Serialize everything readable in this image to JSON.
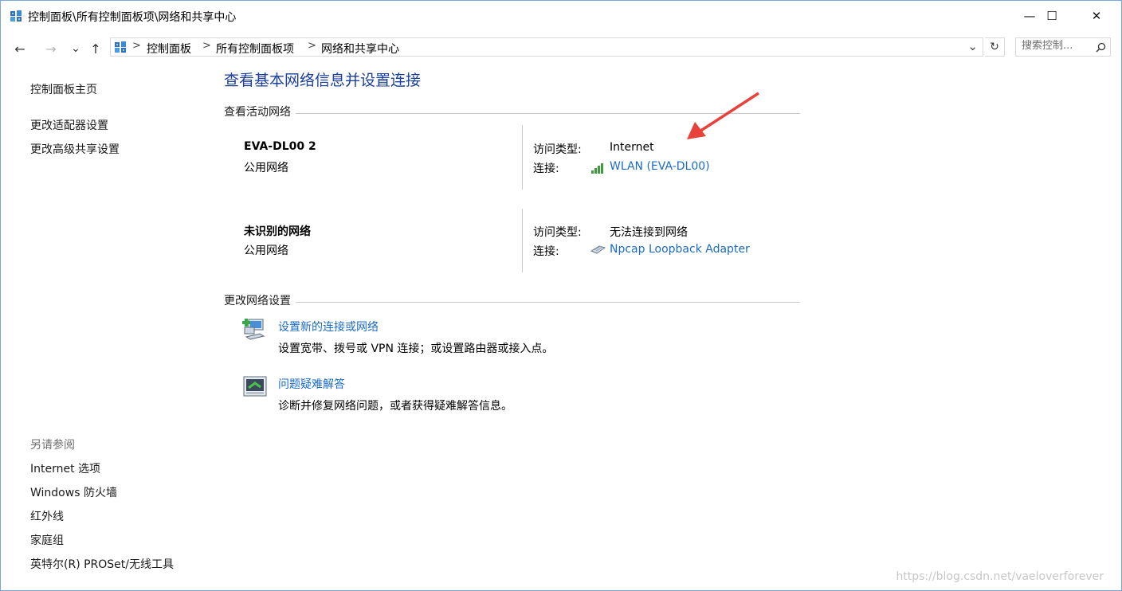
{
  "window": {
    "title": "控制面板\\所有控制面板项\\网络和共享中心",
    "minimize": "—",
    "maximize": "☐",
    "close": "✕"
  },
  "nav": {
    "back": "←",
    "forward": "→",
    "recent": "⌄",
    "up": "↑",
    "breadcrumb": [
      "控制面板",
      "所有控制面板项",
      "网络和共享中心"
    ],
    "separator": ">",
    "dropdown": "⌄",
    "refresh": "↻"
  },
  "search": {
    "placeholder": "搜索控制..."
  },
  "sidebar": {
    "home": "控制面板主页",
    "links": [
      "更改适配器设置",
      "更改高级共享设置"
    ],
    "see_also_label": "另请参阅",
    "see_also": [
      "Internet 选项",
      "Windows 防火墙",
      "红外线",
      "家庭组",
      "英特尔(R) PROSet/无线工具"
    ]
  },
  "main": {
    "title": "查看基本网络信息并设置连接",
    "active_label": "查看活动网络",
    "networks": [
      {
        "name": "EVA-DL00  2",
        "type": "公用网络",
        "access_label": "访问类型:",
        "access": "Internet",
        "conn_label": "连接:",
        "conn": "WLAN (EVA-DL00)",
        "icon": "wifi-signal-icon"
      },
      {
        "name": "未识别的网络",
        "type": "公用网络",
        "access_label": "访问类型:",
        "access": "无法连接到网络",
        "conn_label": "连接:",
        "conn": "Npcap Loopback Adapter",
        "icon": "ethernet-adapter-icon"
      }
    ],
    "change_label": "更改网络设置",
    "tasks": [
      {
        "link": "设置新的连接或网络",
        "desc": "设置宽带、拨号或 VPN 连接；或设置路由器或接入点。",
        "icon": "new-connection-icon"
      },
      {
        "link": "问题疑难解答",
        "desc": "诊断并修复网络问题，或者获得疑难解答信息。",
        "icon": "troubleshoot-icon"
      }
    ]
  },
  "watermark": "https://blog.csdn.net/vaeloverforever",
  "colors": {
    "link": "#1a6bc6",
    "title": "#1a3f9e",
    "arrow": "#e8403a"
  }
}
